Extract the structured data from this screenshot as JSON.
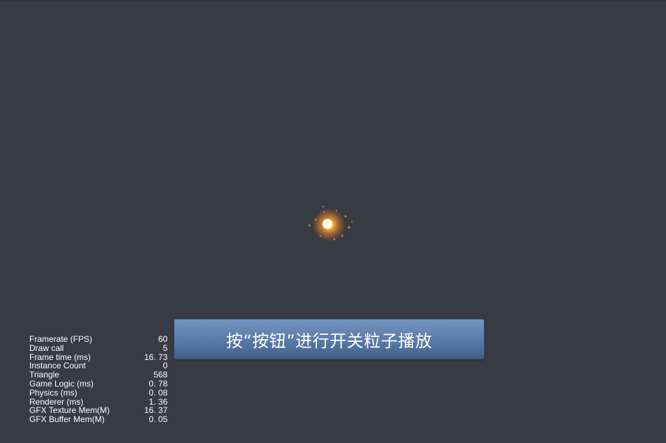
{
  "scene": {
    "effect": "particle-explosion",
    "colors": {
      "background": "#393b42",
      "core": "#fff6b0",
      "glow": "#ff9a1f",
      "sparks": "#ff6a1a"
    }
  },
  "button": {
    "label": "按“按钮”进行开关粒子播放",
    "color": "#6384b1"
  },
  "stats": [
    {
      "label": "Framerate (FPS)",
      "value": "60"
    },
    {
      "label": "Draw call",
      "value": "5"
    },
    {
      "label": "Frame time (ms)",
      "value": "16. 73"
    },
    {
      "label": "Instance Count",
      "value": "0"
    },
    {
      "label": "Triangle",
      "value": "568"
    },
    {
      "label": "Game Logic (ms)",
      "value": "0. 78"
    },
    {
      "label": "Physics (ms)",
      "value": "0. 08"
    },
    {
      "label": "Renderer (ms)",
      "value": "1. 36"
    },
    {
      "label": "GFX Texture Mem(M)",
      "value": "16. 37"
    },
    {
      "label": "GFX Buffer Mem(M)",
      "value": "0. 05"
    }
  ]
}
